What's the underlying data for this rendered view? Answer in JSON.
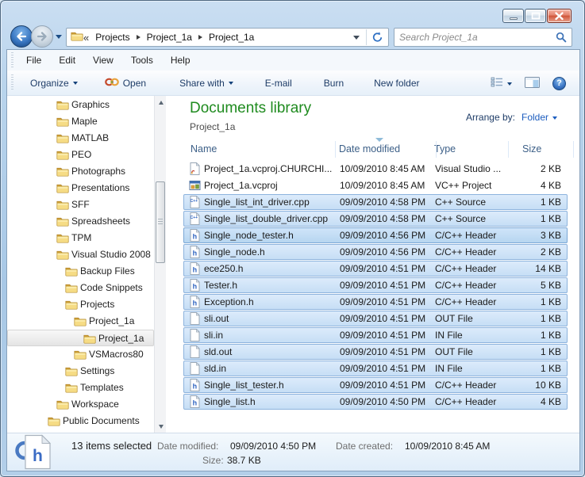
{
  "theme": {
    "selection_fill_top": "#dcebfb",
    "selection_fill_bottom": "#c6def5",
    "selection_border": "#8db3dd",
    "library_title_green": "#1f8b1f",
    "link_blue": "#1c5dbf",
    "column_header_text": "#3c5f87",
    "toolbar_text": "#1e3c67",
    "frame_blue": "#b7d3ec",
    "close_button_red": "#cf5439"
  },
  "window": {
    "caption_buttons": [
      "minimize",
      "restore",
      "close"
    ]
  },
  "navbar": {
    "back": "back",
    "forward": "forward",
    "address": {
      "root_chevron": "«",
      "crumbs": [
        "Projects",
        "Project_1a",
        "Project_1a"
      ]
    },
    "search": {
      "placeholder": "Search Project_1a"
    }
  },
  "menubar": {
    "items": [
      "File",
      "Edit",
      "View",
      "Tools",
      "Help"
    ]
  },
  "toolbar": {
    "items": [
      {
        "label": "Organize",
        "dropdown": true
      },
      {
        "label": "Open",
        "icon": "visual-studio-logo"
      },
      {
        "label": "Share with",
        "dropdown": true
      },
      {
        "label": "E-mail"
      },
      {
        "label": "Burn"
      },
      {
        "label": "New folder"
      }
    ],
    "right_buttons": [
      {
        "icon": "list-view",
        "dropdown": true
      },
      {
        "icon": "preview-pane"
      },
      {
        "icon": "help"
      }
    ]
  },
  "sidebar": {
    "items": [
      {
        "label": "Graphics",
        "level": 1
      },
      {
        "label": "Maple",
        "level": 1
      },
      {
        "label": "MATLAB",
        "level": 1
      },
      {
        "label": "PEO",
        "level": 1
      },
      {
        "label": "Photographs",
        "level": 1
      },
      {
        "label": "Presentations",
        "level": 1
      },
      {
        "label": "SFF",
        "level": 1
      },
      {
        "label": "Spreadsheets",
        "level": 1
      },
      {
        "label": "TPM",
        "level": 1
      },
      {
        "label": "Visual Studio 2008",
        "level": 1
      },
      {
        "label": "Backup Files",
        "level": 2
      },
      {
        "label": "Code Snippets",
        "level": 2
      },
      {
        "label": "Projects",
        "level": 2
      },
      {
        "label": "Project_1a",
        "level": 3
      },
      {
        "label": "Project_1a",
        "level": 4,
        "selected": true
      },
      {
        "label": "VSMacros80",
        "level": 3
      },
      {
        "label": "Settings",
        "level": 2
      },
      {
        "label": "Templates",
        "level": 2
      },
      {
        "label": "Workspace",
        "level": 1
      },
      {
        "label": "Public Documents",
        "level": 0
      }
    ]
  },
  "library": {
    "title": "Documents library",
    "subtitle": "Project_1a",
    "arrange_label": "Arrange by:",
    "arrange_value": "Folder"
  },
  "columns": [
    {
      "label": "Name"
    },
    {
      "label": "Date modified",
      "sort": "desc"
    },
    {
      "label": "Type"
    },
    {
      "label": "Size"
    }
  ],
  "files": [
    {
      "name": "Project_1a.vcproj.CHURCHI...",
      "date": "10/09/2010 8:45 AM",
      "type": "Visual Studio ...",
      "size": "2 KB",
      "icon": "vsuser",
      "selected": false
    },
    {
      "name": "Project_1a.vcproj",
      "date": "10/09/2010 8:45 AM",
      "type": "VC++ Project",
      "size": "4 KB",
      "icon": "vcproj",
      "selected": false
    },
    {
      "name": "Single_list_int_driver.cpp",
      "date": "09/09/2010 4:58 PM",
      "type": "C++ Source",
      "size": "1 KB",
      "icon": "cpp",
      "selected": true
    },
    {
      "name": "Single_list_double_driver.cpp",
      "date": "09/09/2010 4:58 PM",
      "type": "C++ Source",
      "size": "1 KB",
      "icon": "cpp",
      "selected": true
    },
    {
      "name": "Single_node_tester.h",
      "date": "09/09/2010 4:56 PM",
      "type": "C/C++ Header",
      "size": "3 KB",
      "icon": "h",
      "selected": true,
      "focused": true
    },
    {
      "name": "Single_node.h",
      "date": "09/09/2010 4:56 PM",
      "type": "C/C++ Header",
      "size": "2 KB",
      "icon": "h",
      "selected": true
    },
    {
      "name": "ece250.h",
      "date": "09/09/2010 4:51 PM",
      "type": "C/C++ Header",
      "size": "14 KB",
      "icon": "h",
      "selected": true
    },
    {
      "name": "Tester.h",
      "date": "09/09/2010 4:51 PM",
      "type": "C/C++ Header",
      "size": "5 KB",
      "icon": "h",
      "selected": true
    },
    {
      "name": "Exception.h",
      "date": "09/09/2010 4:51 PM",
      "type": "C/C++ Header",
      "size": "1 KB",
      "icon": "h",
      "selected": true
    },
    {
      "name": "sli.out",
      "date": "09/09/2010 4:51 PM",
      "type": "OUT File",
      "size": "1 KB",
      "icon": "blank",
      "selected": true
    },
    {
      "name": "sli.in",
      "date": "09/09/2010 4:51 PM",
      "type": "IN File",
      "size": "1 KB",
      "icon": "blank",
      "selected": true
    },
    {
      "name": "sld.out",
      "date": "09/09/2010 4:51 PM",
      "type": "OUT File",
      "size": "1 KB",
      "icon": "blank",
      "selected": true
    },
    {
      "name": "sld.in",
      "date": "09/09/2010 4:51 PM",
      "type": "IN File",
      "size": "1 KB",
      "icon": "blank",
      "selected": true
    },
    {
      "name": "Single_list_tester.h",
      "date": "09/09/2010 4:51 PM",
      "type": "C/C++ Header",
      "size": "10 KB",
      "icon": "h",
      "selected": true
    },
    {
      "name": "Single_list.h",
      "date": "09/09/2010 4:50 PM",
      "type": "C/C++ Header",
      "size": "4 KB",
      "icon": "h",
      "selected": true
    }
  ],
  "statusbar": {
    "selection_count": "13 items selected",
    "date_modified_label": "Date modified:",
    "date_modified": "09/09/2010 4:50 PM",
    "size_label": "Size:",
    "size": "38.7 KB",
    "date_created_label": "Date created:",
    "date_created": "10/09/2010 8:45 AM"
  }
}
